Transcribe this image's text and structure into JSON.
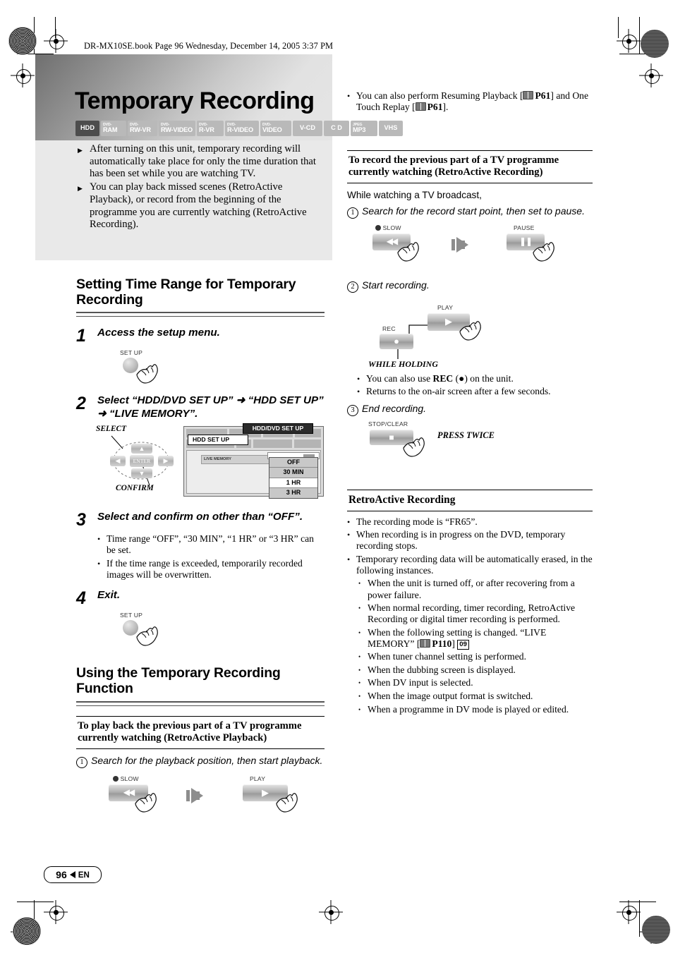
{
  "running_head": "DR-MX10SE.book  Page 96  Wednesday, December 14, 2005  3:37 PM",
  "title": "Temporary Recording",
  "media_badges": [
    {
      "pre": "",
      "main": "HDD",
      "active": true
    },
    {
      "pre": "DVD-",
      "main": "RAM",
      "active": false
    },
    {
      "pre": "DVD-",
      "main": "RW-VR",
      "active": false
    },
    {
      "pre": "DVD-",
      "main": "RW-VIDEO",
      "active": false
    },
    {
      "pre": "DVD-",
      "main": "R-VR",
      "active": false
    },
    {
      "pre": "DVD-",
      "main": "R-VIDEO",
      "active": false
    },
    {
      "pre": "DVD-",
      "main": "VIDEO",
      "active": false
    },
    {
      "pre": "",
      "main": "V-CD",
      "active": false
    },
    {
      "pre": "",
      "main": "C D",
      "active": false
    },
    {
      "pre": "JPEG",
      "main": "MP3",
      "active": false
    },
    {
      "pre": "",
      "main": "VHS",
      "active": false
    }
  ],
  "intro_bullets": [
    "After turning on this unit, temporary recording will automatically take place for only the time duration that has been set while you are watching TV.",
    "You can play back missed scenes (RetroActive Playback), or record from the beginning of the programme you are currently watching (RetroActive Recording)."
  ],
  "section_setting": {
    "heading": "Setting Time Range for Temporary Recording",
    "steps": [
      {
        "num": "1",
        "text": "Access the setup menu."
      },
      {
        "num": "2",
        "text": "Select “HDD/DVD SET UP” ➜ “HDD SET UP” ➜ “LIVE MEMORY”."
      },
      {
        "num": "3",
        "text": "Select and confirm on other than “OFF”."
      },
      {
        "num": "4",
        "text": "Exit."
      }
    ],
    "step1_button_label": "SET UP",
    "step2_art": {
      "select_label": "SELECT",
      "confirm_label": "CONFIRM",
      "enter_label": "ENTER",
      "callout_top": "HDD/DVD SET UP",
      "callout_second": "HDD SET UP",
      "row_label": "LIVE MEMORY",
      "options": [
        "OFF",
        "30 MIN",
        "1 HR",
        "3 HR"
      ],
      "selected_option": "1 HR"
    },
    "step3_bullets": [
      "Time range “OFF”, “30 MIN”, “1 HR” or “3 HR” can be set.",
      "If the time range is exceeded, temporarily recorded images will be overwritten."
    ],
    "step4_button_label": "SET UP"
  },
  "section_using": {
    "heading": "Using the Temporary Recording Function",
    "sub_playback": "To play back the previous part of a TV programme currently watching (RetroActive Playback)",
    "play_step": {
      "num": "1",
      "text": "Search for the playback position, then start playback."
    },
    "btn_slow": "SLOW",
    "btn_play": "PLAY"
  },
  "right_column": {
    "top_bullet_parts": {
      "a": "You can also perform Resuming Playback [",
      "p1": "P61",
      "b": "] and One Touch Replay [",
      "p2": "P61",
      "c": "]."
    },
    "sub_recording": "To record the previous part of a TV programme currently watching (RetroActive Recording)",
    "lead_in": "While watching a TV broadcast,",
    "steps": [
      {
        "num": "1",
        "text": "Search for the record start point, then set to pause."
      },
      {
        "num": "2",
        "text": "Start recording."
      },
      {
        "num": "3",
        "text": "End recording."
      }
    ],
    "btn_slow": "SLOW",
    "btn_pause": "PAUSE",
    "btn_play": "PLAY",
    "btn_rec": "REC",
    "btn_stop": "STOP/CLEAR",
    "while_holding": "WHILE HOLDING",
    "press_twice": "PRESS TWICE",
    "mid_bullets": [
      {
        "a": "You can also use ",
        "bold": "REC",
        "b": " (●) on the unit."
      },
      {
        "a": "Returns to the on-air screen after a few seconds.",
        "bold": "",
        "b": ""
      }
    ],
    "retro": {
      "heading": "RetroActive Recording",
      "bullets": [
        "The recording mode is “FR65”.",
        "When recording is in progress on the DVD, temporary recording stops.",
        "Temporary recording data will be automatically erased, in the following instances."
      ],
      "sub_bullets": [
        "When the unit is turned off, or after recovering from a power failure.",
        "When normal recording, timer recording, RetroActive Recording or digital timer recording is performed.",
        "When tuner channel setting is performed.",
        "When the dubbing screen is displayed.",
        "When DV input is selected.",
        "When the image output format is switched.",
        "When a programme in DV mode is played or edited."
      ],
      "live_memory_bullet": {
        "a": "When the following setting is changed. “LIVE MEMORY” [",
        "page": "P110",
        "b": "]",
        "chapter": "09"
      }
    }
  },
  "footer": {
    "page": "96",
    "lang": "EN"
  }
}
